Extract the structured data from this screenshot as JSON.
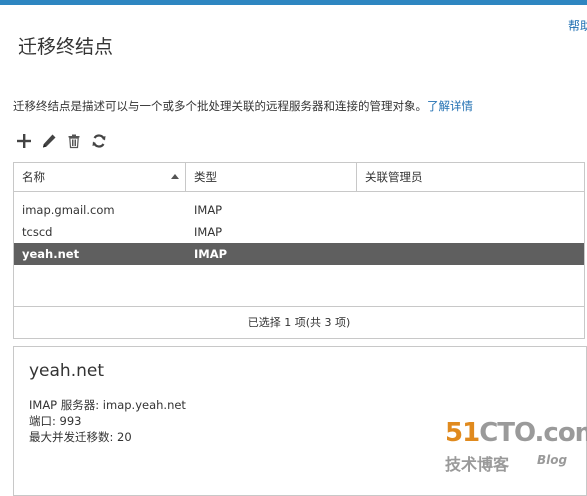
{
  "header": {
    "help_label": "帮助",
    "title": "迁移终结点"
  },
  "description": {
    "text": "迁移终结点是描述可以与一个或多个批处理关联的远程服务器和连接的管理对象。",
    "learn_more": "了解详情"
  },
  "toolbar": {
    "icons": [
      "add-icon",
      "edit-icon",
      "delete-icon",
      "refresh-icon"
    ]
  },
  "grid": {
    "columns": [
      {
        "label": "名称",
        "sort": "ascending"
      },
      {
        "label": "类型"
      },
      {
        "label": "关联管理员"
      }
    ],
    "rows": [
      {
        "name": "imap.gmail.com",
        "type": "IMAP",
        "admin": "",
        "selected": false
      },
      {
        "name": "tcscd",
        "type": "IMAP",
        "admin": "",
        "selected": false
      },
      {
        "name": "yeah.net",
        "type": "IMAP",
        "admin": "",
        "selected": true
      }
    ],
    "footer": "已选择 1 项(共 3 项)"
  },
  "details": {
    "title": "yeah.net",
    "server": "IMAP 服务器: imap.yeah.net",
    "port": "端口: 993",
    "max_migrations": "最大并发迁移数: 20"
  },
  "watermark": {
    "main_accent": "51",
    "main_rest": "CTO.com",
    "sub": "技术博客",
    "blog": "Blog"
  },
  "colors": {
    "accent": "#2e86c1",
    "link": "#1f6fb2",
    "selected_row": "#5f5f5f"
  }
}
